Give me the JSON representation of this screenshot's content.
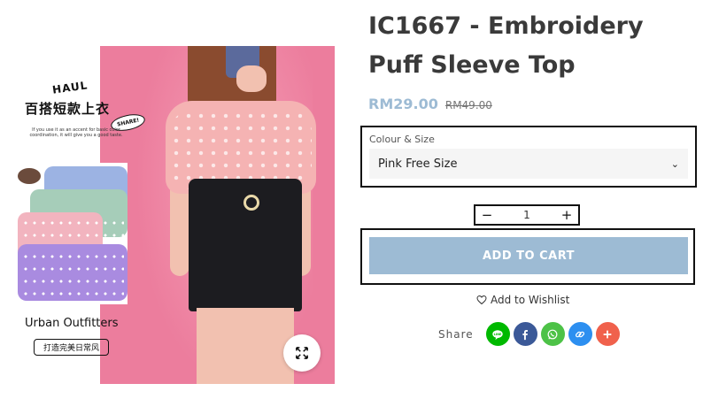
{
  "product": {
    "title": "IC1667 - Embroidery Puff Sleeve Top",
    "price": "RM29.00",
    "compare_price": "RM49.00"
  },
  "variant": {
    "label": "Colour & Size",
    "selected": "Pink Free Size"
  },
  "quantity": {
    "value": "1",
    "decrease_symbol": "−",
    "increase_symbol": "+"
  },
  "cart": {
    "button_label": "ADD TO CART"
  },
  "wishlist": {
    "label": "Add to Wishlist"
  },
  "share": {
    "label": "Share",
    "icons": [
      {
        "name": "line-icon",
        "color": "#00b900"
      },
      {
        "name": "facebook-icon",
        "color": "#3b5998"
      },
      {
        "name": "whatsapp-icon",
        "color": "#4dc247"
      },
      {
        "name": "copy-link-icon",
        "color": "#2d8ff0"
      },
      {
        "name": "more-share-icon",
        "color": "#f0614c"
      }
    ]
  },
  "image": {
    "haul_text": "HAUL",
    "cn_title": "百搭短款上衣",
    "share_tag": "SHARE!",
    "tiny_caption": "If you use it as an accent for basic color coordination, it will give you a good taste.",
    "brand_caption": "Urban Outfitters",
    "cn_pill": "打造完美日常风"
  },
  "colors": {
    "accent": "#9dbbd4",
    "title": "#3a3a3a"
  }
}
